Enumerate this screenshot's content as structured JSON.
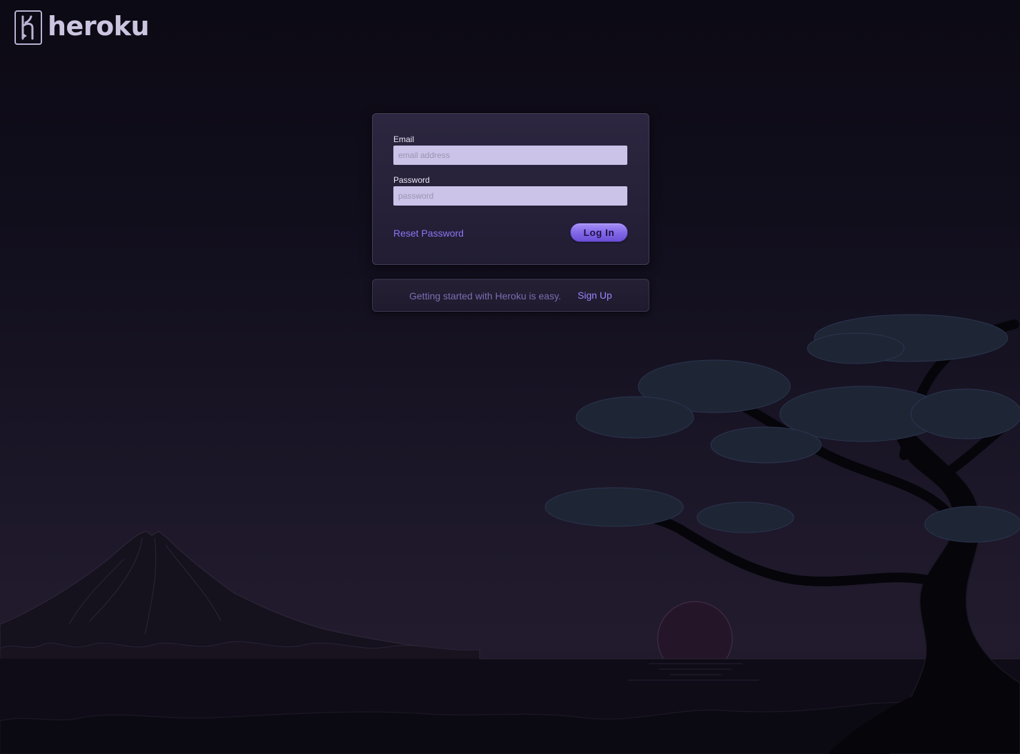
{
  "brand": {
    "name": "heroku",
    "logo_icon": "heroku-logo-icon"
  },
  "login_form": {
    "email_label": "Email",
    "email_placeholder": "email address",
    "email_value": "",
    "password_label": "Password",
    "password_placeholder": "password",
    "password_value": "",
    "reset_link": "Reset Password",
    "submit_label": "Log In"
  },
  "signup": {
    "text": "Getting started with Heroku is easy.",
    "link": "Sign Up"
  },
  "colors": {
    "accent": "#8f75f5",
    "button": "#8468e8",
    "input_bg": "#cbc3e8",
    "page_bg": "#0c0a14"
  }
}
